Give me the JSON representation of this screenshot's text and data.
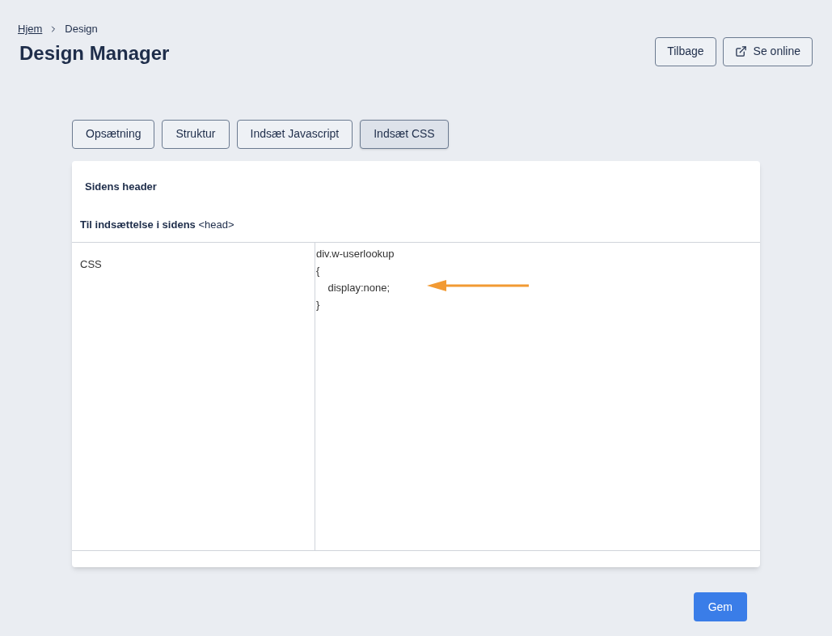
{
  "breadcrumb": [
    {
      "label": "Hjem",
      "link": true
    },
    {
      "label": "Design",
      "link": false
    }
  ],
  "title": "Design Manager",
  "header_buttons": [
    {
      "label": "Tilbage",
      "kind": "plain"
    },
    {
      "label": "Se online",
      "kind": "external"
    }
  ],
  "tabs": [
    {
      "label": "Opsætning",
      "selected": false
    },
    {
      "label": "Struktur",
      "selected": false
    },
    {
      "label": "Indsæt Javascript",
      "selected": false
    },
    {
      "label": "Indsæt CSS",
      "selected": true
    }
  ],
  "panel": {
    "title": "Sidens header",
    "section": "**Til indsættelse i sidens** <head>",
    "field_label": "CSS",
    "code_lines": [
      "div.w-userlookup",
      "{",
      "    display:none;",
      "}"
    ]
  },
  "save_button": "Gem"
}
